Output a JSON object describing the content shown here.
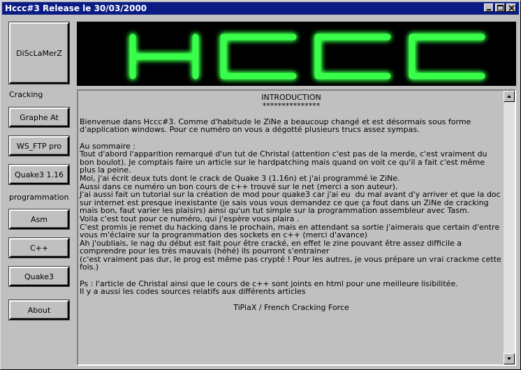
{
  "window": {
    "title": "Hccc#3 Release le 30/03/2000"
  },
  "sidebar": {
    "disclaimer": "DiScLaMerZ",
    "cracking_label": "Cracking",
    "cracking_items": [
      "Graphe At",
      "WS_FTP pro",
      "Quake3 1.16"
    ],
    "programmation_label": "programmation",
    "programmation_items": [
      "Asm",
      "C++",
      "Quake3"
    ],
    "about": "About"
  },
  "banner": {
    "logo_text": "HCCC",
    "glow_color": "#39ff4a"
  },
  "content": {
    "heading": "INTRODUCTION",
    "underline": "***************",
    "paragraph1": "Bienvenue dans Hccc#3. Comme d'habitude le ZiNe a beaucoup changé et est désormais sous forme d'application windows. Pour ce numéro on vous a dégotté plusieurs trucs assez sympas.",
    "summary_title": "Au sommaire :",
    "summary_body": "Tout d'abord l'apparition remarqué d'un tut de Christal (attention c'est pas de la merde, c'est vraiment du bon boulot). Je comptais faire un article sur le hardpatching mais quand on voit ce qu'il a fait c'est même plus la peine.\nMoi, j'ai écrit deux tuts dont le crack de Quake 3 (1.16n) et j'ai programmé le ZiNe.\nAussi dans ce numéro un bon cours de c++ trouvé sur le net (merci a son auteur).\nJ'ai aussi fait un tutorial sur la création de mod pour quake3 car j'ai eu  du mal avant d'y arriver et que la doc sur internet est presque inexistante (je sais vous vous demandez ce que ça fout dans un ZiNe de cracking mais bon, faut varier les plaisirs) ainsi qu'un tut simple sur la programmation assembleur avec Tasm.\nVoila c'est tout pour ce numéro, qui j'espère vous plaira .\nC'est promis je remet du hacking dans le prochain, mais en attendant sa sortie j'aimerais que certain d'entre vous m'éclaire sur la programmation des sockets en c++ (merci d'avance)\nAh j'oubliais, le nag du début est fait pour être cracké, en effet le zine pouvant être assez difficile a comprendre pour les très mauvais (héhé) ils pourront s'entrainer\n(c'est vraiment pas dur, le prog est même pas crypté ! Pour les autres, je vous prépare un vrai crackme cette fois.)",
    "ps": "Ps : l'article de Christal ainsi que le cours de c++ sont joints en html pour une meilleure lisibilitée.\nIl y a aussi les codes sources relatifs aux différents articles",
    "signature": "TiPiaX / French Cracking Force"
  },
  "colors": {
    "titlebar": "#0a1c84",
    "face": "#c0c0c0"
  }
}
